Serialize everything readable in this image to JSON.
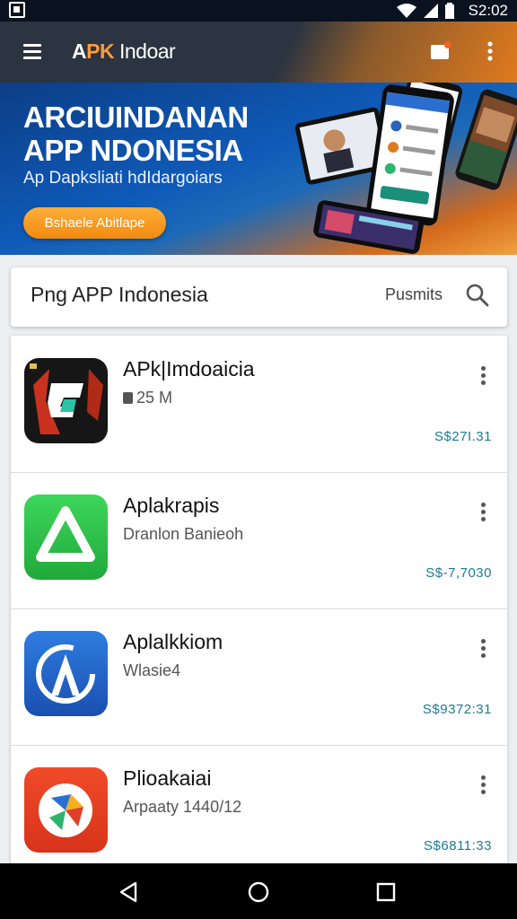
{
  "status_bar": {
    "time": "S2:02",
    "icons": [
      "photo-icon",
      "wifi-icon",
      "signal-icon",
      "battery-icon"
    ]
  },
  "app_bar": {
    "title_a": "A",
    "title_pk": "PK",
    "title_rest": " Indoar",
    "menu_icon": "menu-icon",
    "notification_icon": "notification-icon",
    "overflow_icon": "more-vert-icon",
    "colors": {
      "bar": "#2b3440",
      "accent": "#ff9a3d",
      "badge": "#f26522"
    }
  },
  "banner": {
    "title_line1": "ARCIUINDANAN",
    "title_line2": "APP NDONESIA",
    "subtitle": "Ap Dapksliati hdIdargoiars",
    "button_label": "Bshaele  Abitlape",
    "colors": {
      "bg_start": "#0b3e86",
      "bg_end": "#f0a040",
      "button": "#f59a1e"
    }
  },
  "search": {
    "text": "Png APP Indonesia",
    "action_label": "Pusmits",
    "icon": "search-icon"
  },
  "apps": [
    {
      "name": "APk|Imdoaicia",
      "subtitle": "25 M",
      "subtitle_icon": "storage-icon",
      "price": "S$27I.31",
      "icon": "apk-logo-icon"
    },
    {
      "name": "Aplakrapis",
      "subtitle": "Dranlon Banieoh",
      "price": "S$-7,7030",
      "icon": "green-triangle-app-icon"
    },
    {
      "name": "Aplalkkiom",
      "subtitle": "Wlasie4",
      "price": "S$9372:31",
      "icon": "blue-a-app-icon"
    },
    {
      "name": "Plioakaiai",
      "subtitle": "Arpaaty 1440/12",
      "price": "S$6811:33",
      "icon": "red-photo-app-icon"
    }
  ],
  "nav_bar": {
    "back": "back-icon",
    "home": "home-icon",
    "recents": "recents-icon"
  }
}
